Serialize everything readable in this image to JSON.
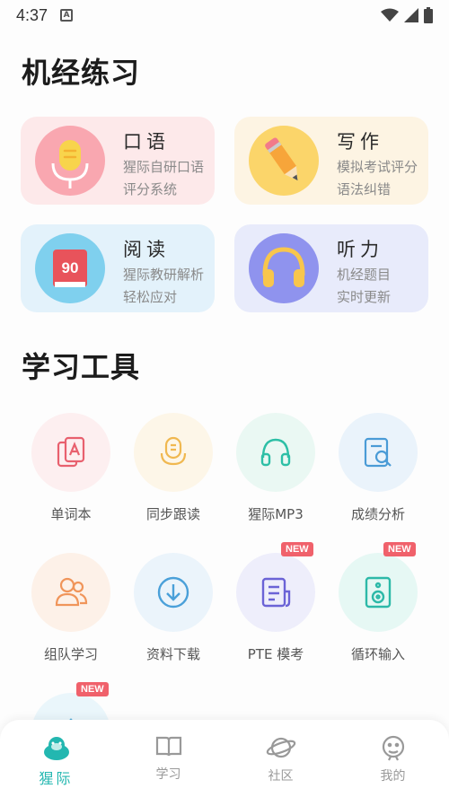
{
  "status": {
    "time": "4:37",
    "app_indicator": "A"
  },
  "sections": {
    "practice_title": "机经练习",
    "tools_title": "学习工具"
  },
  "practice_cards": [
    {
      "title": "口语",
      "line1": "猩际自研口语",
      "line2": "评分系统",
      "icon": "microphone-icon",
      "bg": "#fde9ea"
    },
    {
      "title": "写作",
      "line1": "模拟考试评分",
      "line2": "语法纠错",
      "icon": "pencil-icon",
      "bg": "#fdf4e3"
    },
    {
      "title": "阅读",
      "line1": "猩际教研解析",
      "line2": "轻松应对",
      "icon": "book-90-icon",
      "book_number": "90",
      "bg": "#e3f2fb"
    },
    {
      "title": "听力",
      "line1": "机经题目",
      "line2": "实时更新",
      "icon": "headphones-icon",
      "bg": "#e8ebfb"
    }
  ],
  "tools": [
    {
      "label": "单词本",
      "icon": "vocabulary-cards-icon",
      "badge": ""
    },
    {
      "label": "同步跟读",
      "icon": "speech-bubble-icon",
      "badge": ""
    },
    {
      "label": "猩际MP3",
      "icon": "headphones-icon",
      "badge": ""
    },
    {
      "label": "成绩分析",
      "icon": "score-analysis-icon",
      "badge": ""
    },
    {
      "label": "组队学习",
      "icon": "team-icon",
      "badge": ""
    },
    {
      "label": "资料下载",
      "icon": "download-icon",
      "badge": ""
    },
    {
      "label": "PTE 模考",
      "icon": "mock-exam-icon",
      "badge": "NEW"
    },
    {
      "label": "循环输入",
      "icon": "speaker-icon",
      "badge": "NEW"
    },
    {
      "label": "",
      "icon": "partial-tool-icon",
      "badge": "NEW"
    }
  ],
  "nav": [
    {
      "label": "猩际",
      "icon": "gorilla-icon",
      "active": true
    },
    {
      "label": "学习",
      "icon": "open-book-icon",
      "active": false
    },
    {
      "label": "社区",
      "icon": "planet-icon",
      "active": false
    },
    {
      "label": "我的",
      "icon": "face-icon",
      "active": false
    }
  ],
  "colors": {
    "accent": "#23b7b0",
    "badge": "#f0616b"
  }
}
